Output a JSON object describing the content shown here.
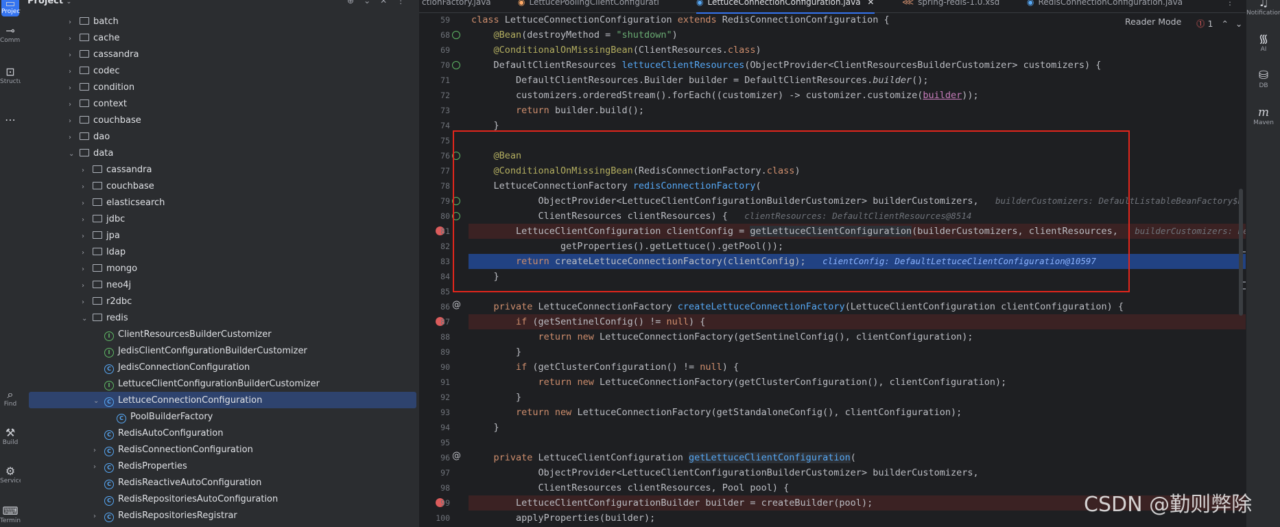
{
  "left_toolbar": [
    {
      "label": "Project",
      "icon": "folder-icon"
    },
    {
      "label": "Commit",
      "icon": "commit-icon"
    },
    {
      "label": "Structure",
      "icon": "structure-icon"
    },
    {
      "label": "",
      "icon": "more-icon"
    },
    {
      "label": "Find",
      "icon": "find-icon"
    },
    {
      "label": "Build",
      "icon": "hammer-icon"
    },
    {
      "label": "Services",
      "icon": "services-icon"
    },
    {
      "label": "Terminal",
      "icon": "terminal-icon"
    }
  ],
  "project": {
    "title": "Project",
    "tree": [
      {
        "label": "batch",
        "type": "folder",
        "indent": 1,
        "chevron": "›"
      },
      {
        "label": "cache",
        "type": "folder",
        "indent": 1,
        "chevron": "›"
      },
      {
        "label": "cassandra",
        "type": "folder",
        "indent": 1,
        "chevron": "›"
      },
      {
        "label": "codec",
        "type": "folder",
        "indent": 1,
        "chevron": "›"
      },
      {
        "label": "condition",
        "type": "folder",
        "indent": 1,
        "chevron": "›"
      },
      {
        "label": "context",
        "type": "folder",
        "indent": 1,
        "chevron": "›"
      },
      {
        "label": "couchbase",
        "type": "folder",
        "indent": 1,
        "chevron": "›"
      },
      {
        "label": "dao",
        "type": "folder",
        "indent": 1,
        "chevron": "›"
      },
      {
        "label": "data",
        "type": "folder",
        "indent": 1,
        "chevron": "⌄"
      },
      {
        "label": "cassandra",
        "type": "folder",
        "indent": 2,
        "chevron": "›"
      },
      {
        "label": "couchbase",
        "type": "folder",
        "indent": 2,
        "chevron": "›"
      },
      {
        "label": "elasticsearch",
        "type": "folder",
        "indent": 2,
        "chevron": "›"
      },
      {
        "label": "jdbc",
        "type": "folder",
        "indent": 2,
        "chevron": "›"
      },
      {
        "label": "jpa",
        "type": "folder",
        "indent": 2,
        "chevron": "›"
      },
      {
        "label": "ldap",
        "type": "folder",
        "indent": 2,
        "chevron": "›"
      },
      {
        "label": "mongo",
        "type": "folder",
        "indent": 2,
        "chevron": "›"
      },
      {
        "label": "neo4j",
        "type": "folder",
        "indent": 2,
        "chevron": "›"
      },
      {
        "label": "r2dbc",
        "type": "folder",
        "indent": 2,
        "chevron": "›"
      },
      {
        "label": "redis",
        "type": "folder",
        "indent": 2,
        "chevron": "⌄"
      },
      {
        "label": "ClientResourcesBuilderCustomizer",
        "type": "interface",
        "indent": 3,
        "chevron": ""
      },
      {
        "label": "JedisClientConfigurationBuilderCustomizer",
        "type": "interface",
        "indent": 3,
        "chevron": ""
      },
      {
        "label": "JedisConnectionConfiguration",
        "type": "class",
        "indent": 3,
        "chevron": ""
      },
      {
        "label": "LettuceClientConfigurationBuilderCustomizer",
        "type": "interface",
        "indent": 3,
        "chevron": ""
      },
      {
        "label": "LettuceConnectionConfiguration",
        "type": "class",
        "indent": 3,
        "chevron": "⌄",
        "selected": true
      },
      {
        "label": "PoolBuilderFactory",
        "type": "inner",
        "indent": 4,
        "chevron": ""
      },
      {
        "label": "RedisAutoConfiguration",
        "type": "class",
        "indent": 3,
        "chevron": ""
      },
      {
        "label": "RedisConnectionConfiguration",
        "type": "class",
        "indent": 3,
        "chevron": "›"
      },
      {
        "label": "RedisProperties",
        "type": "class",
        "indent": 3,
        "chevron": "›"
      },
      {
        "label": "RedisReactiveAutoConfiguration",
        "type": "class",
        "indent": 3,
        "chevron": ""
      },
      {
        "label": "RedisRepositoriesAutoConfiguration",
        "type": "class",
        "indent": 3,
        "chevron": ""
      },
      {
        "label": "RedisRepositoriesRegistrar",
        "type": "class",
        "indent": 3,
        "chevron": "›"
      }
    ]
  },
  "tabs": [
    {
      "label": "ctionFactory.java",
      "active": false
    },
    {
      "label": "LettucePoolingClientConfiguration.java",
      "active": false
    },
    {
      "label": "LettuceConnectionConfiguration.java",
      "active": true
    },
    {
      "label": "spring-redis-1.0.xsd",
      "active": false
    },
    {
      "label": "RedisConnectionConfiguration.java",
      "active": false
    }
  ],
  "editor": {
    "reader_mode": "Reader Mode",
    "error_count": "1",
    "lines": [
      {
        "n": "59",
        "html": "<span class='kw'>class</span> LettuceConnectionConfiguration <span class='kw'>extends</span> RedisConnectionConfiguration {"
      },
      {
        "n": "68",
        "html": "    <span class='an'>@Bean</span>(destroyMethod = <span class='st'>\"shutdown\"</span>)",
        "mark": "gi"
      },
      {
        "n": "69",
        "html": "    <span class='an'>@ConditionalOnMissingBean</span>(ClientResources.<span class='kw'>class</span>)"
      },
      {
        "n": "70",
        "html": "    DefaultClientResources <span class='fn'>lettuceClientResources</span>(ObjectProvider&lt;ClientResourcesBuilderCustomizer&gt; customizers) {",
        "mark": "gi"
      },
      {
        "n": "71",
        "html": "        DefaultClientResources.Builder builder = DefaultClientResources.<span class='it'>builder</span>();"
      },
      {
        "n": "72",
        "html": "        customizers.orderedStream().forEach((customizer) -&gt; customizer.customize(<span style='color:#c77dbb;text-decoration:underline'>builder</span>));"
      },
      {
        "n": "73",
        "html": "        <span class='kw'>return</span> builder.build();"
      },
      {
        "n": "74",
        "html": "    }"
      },
      {
        "n": "75",
        "html": ""
      },
      {
        "n": "76",
        "html": "    <span class='an'>@Bean</span>",
        "mark": "gi"
      },
      {
        "n": "77",
        "html": "    <span class='an'>@ConditionalOnMissingBean</span>(RedisConnectionFactory.<span class='kw'>class</span>)"
      },
      {
        "n": "78",
        "html": "    LettuceConnectionFactory <span class='fn'>redisConnectionFactory</span>("
      },
      {
        "n": "79",
        "html": "            ObjectProvider&lt;LettuceClientConfigurationBuilderCustomizer&gt; builderCustomizers,   <span class='hint'>builderCustomizers: DefaultListableBeanFactory$D</span>",
        "mark": "gi"
      },
      {
        "n": "80",
        "html": "            ClientResources clientResources) {   <span class='hint'>clientResources: DefaultClientResources@8514</span>",
        "mark": "gi"
      },
      {
        "n": "81",
        "html": "        LettuceClientConfiguration clientConfig = <span style='background:#2c3036'>getLettuceClientConfiguration</span>(builderCustomizers, clientResources,   <span class='hint'>builderCustomizers: De</span>",
        "mark": "bp"
      },
      {
        "n": "82",
        "html": "                getProperties().getLettuce().getPool());"
      },
      {
        "n": "83",
        "html": "        <span class='kw'>return</span> createLettuceConnectionFactory(clientConfig);   <span class='hint2'>clientConfig: DefaultLettuceClientConfiguration@10597</span>",
        "mark": "cur"
      },
      {
        "n": "84",
        "html": "    }"
      },
      {
        "n": "85",
        "html": ""
      },
      {
        "n": "86",
        "html": "    <span class='kw'>private</span> LettuceConnectionFactory <span class='fn'>createLettuceConnectionFactory</span>(LettuceClientConfiguration clientConfiguration) {",
        "mark": "at"
      },
      {
        "n": "87",
        "html": "        <span class='kw'>if</span> (getSentinelConfig() != <span class='kw'>null</span>) {",
        "mark": "bp"
      },
      {
        "n": "88",
        "html": "            <span class='kw'>return new</span> LettuceConnectionFactory(getSentinelConfig(), clientConfiguration);"
      },
      {
        "n": "89",
        "html": "        }"
      },
      {
        "n": "90",
        "html": "        <span class='kw'>if</span> (getClusterConfiguration() != <span class='kw'>null</span>) {"
      },
      {
        "n": "91",
        "html": "            <span class='kw'>return new</span> LettuceConnectionFactory(getClusterConfiguration(), clientConfiguration);"
      },
      {
        "n": "92",
        "html": "        }"
      },
      {
        "n": "93",
        "html": "        <span class='kw'>return new</span> LettuceConnectionFactory(getStandaloneConfig(), clientConfiguration);"
      },
      {
        "n": "94",
        "html": "    }"
      },
      {
        "n": "95",
        "html": ""
      },
      {
        "n": "96",
        "html": "    <span class='kw'>private</span> LettuceClientConfiguration <span class='fn' style='background:#2c3036'>getLettuceClientConfiguration</span>(",
        "mark": "at"
      },
      {
        "n": "97",
        "html": "            ObjectProvider&lt;LettuceClientConfigurationBuilderCustomizer&gt; builderCustomizers,"
      },
      {
        "n": "98",
        "html": "            ClientResources clientResources, Pool pool) {"
      },
      {
        "n": "99",
        "html": "        LettuceClientConfigurationBuilder builder = createBuilder(pool);",
        "mark": "bp"
      },
      {
        "n": "100",
        "html": "        applyProperties(builder);"
      }
    ]
  },
  "right_toolbar": [
    {
      "label": "Notifications",
      "icon": "bell-icon"
    },
    {
      "label": "AI",
      "icon": "ai-icon"
    },
    {
      "label": "DB",
      "icon": "database-icon"
    },
    {
      "label": "Maven",
      "icon": "maven-icon"
    }
  ],
  "watermark": "CSDN @勤则弊除",
  "colors": {
    "accent": "#3574f0",
    "breakpoint": "#db5c5c",
    "highlight_box": "#e2261c"
  }
}
